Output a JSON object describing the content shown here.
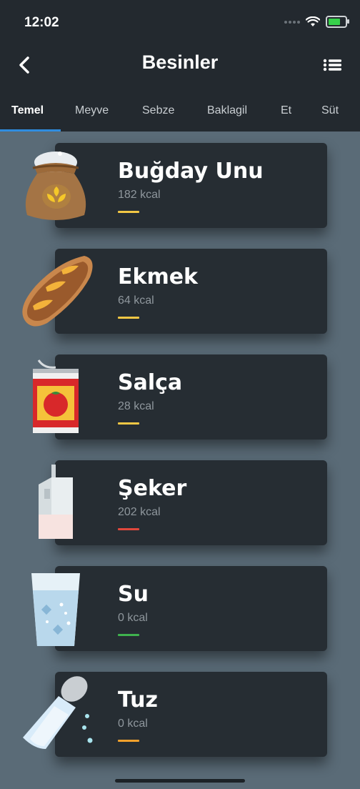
{
  "status": {
    "time": "12:02"
  },
  "header": {
    "title": "Besinler"
  },
  "tabs": [
    {
      "label": "Temel",
      "active": true
    },
    {
      "label": "Meyve"
    },
    {
      "label": "Sebze"
    },
    {
      "label": "Baklagil"
    },
    {
      "label": "Et"
    },
    {
      "label": "Süt"
    }
  ],
  "foods": [
    {
      "name": "Buğday Unu",
      "kcal": "182 kcal",
      "level_color": "#f2c744",
      "icon": "flour-sack-icon"
    },
    {
      "name": "Ekmek",
      "kcal": "64 kcal",
      "level_color": "#f2c744",
      "icon": "bread-icon"
    },
    {
      "name": "Salça",
      "kcal": "28 kcal",
      "level_color": "#f2c744",
      "icon": "tomato-paste-can-icon"
    },
    {
      "name": "Şeker",
      "kcal": "202 kcal",
      "level_color": "#e0483c",
      "icon": "sugar-box-icon"
    },
    {
      "name": "Su",
      "kcal": "0 kcal",
      "level_color": "#3fb24e",
      "icon": "water-glass-icon"
    },
    {
      "name": "Tuz",
      "kcal": "0 kcal",
      "level_color": "#f2a12c",
      "icon": "salt-shaker-icon"
    }
  ],
  "colors": {
    "accent": "#2f8de0",
    "card": "#262d33",
    "background": "#5a6b77"
  }
}
